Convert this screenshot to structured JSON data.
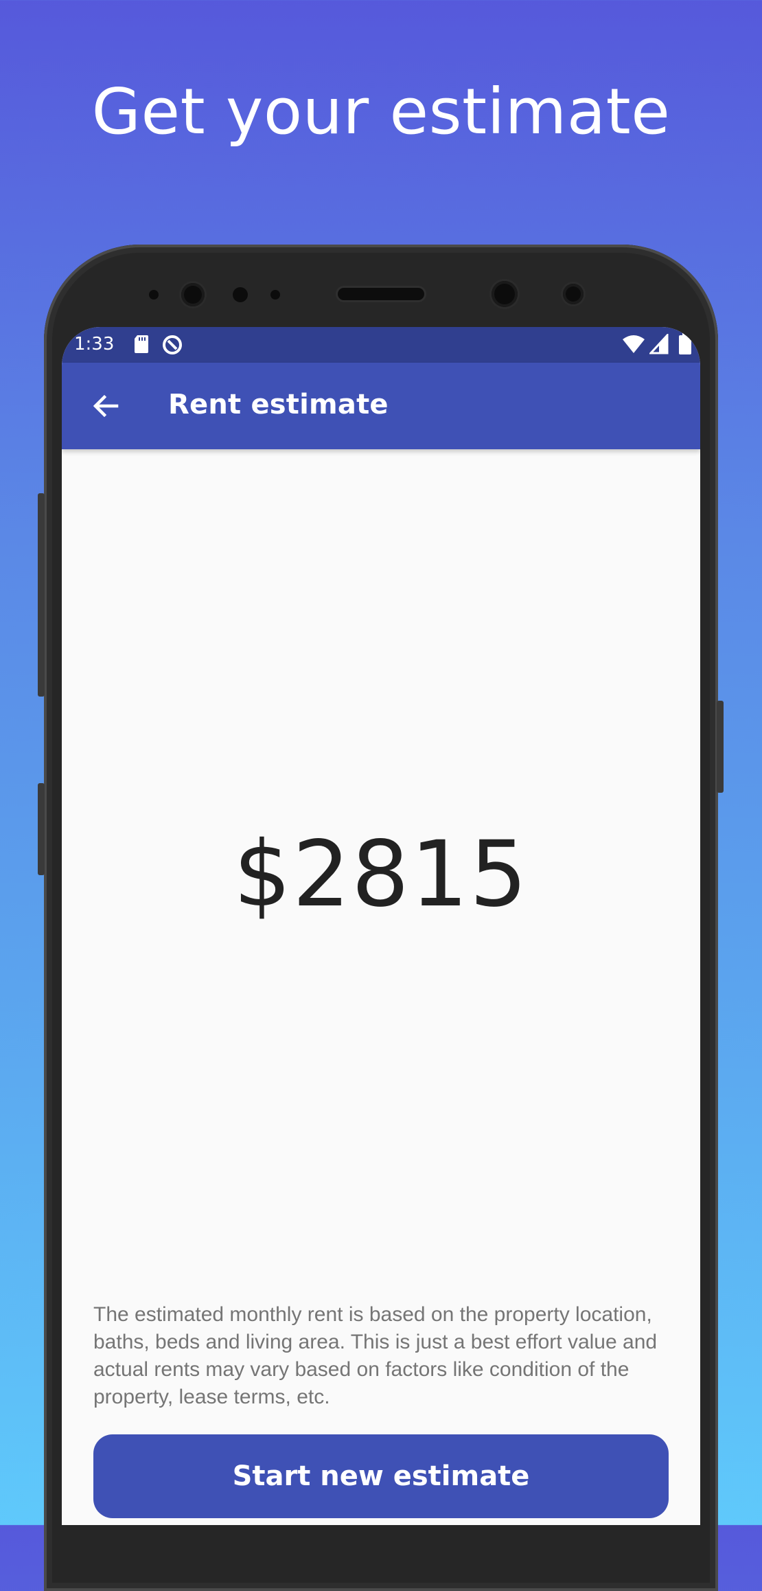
{
  "headline": "Get your estimate",
  "status_bar": {
    "time": "1:33",
    "icons": [
      "sd-card-icon",
      "accessibility-icon",
      "wifi-icon",
      "cellular-icon",
      "battery-icon"
    ]
  },
  "app_bar": {
    "title": "Rent estimate",
    "back_icon": "arrow-left-icon"
  },
  "estimate": {
    "value": "$2815"
  },
  "disclaimer": "The estimated monthly rent is based on the property location, baths, beds and living area. This is just a best effort value and actual rents may vary based on factors like condition of the property, lease terms, etc.",
  "actions": {
    "start_new_label": "Start new estimate"
  },
  "colors": {
    "primary": "#3f51b5",
    "status_bar": "#303f8f",
    "background_top": "#5659db",
    "background_bottom": "#5fc9fb",
    "screen_background": "#fafafa"
  }
}
